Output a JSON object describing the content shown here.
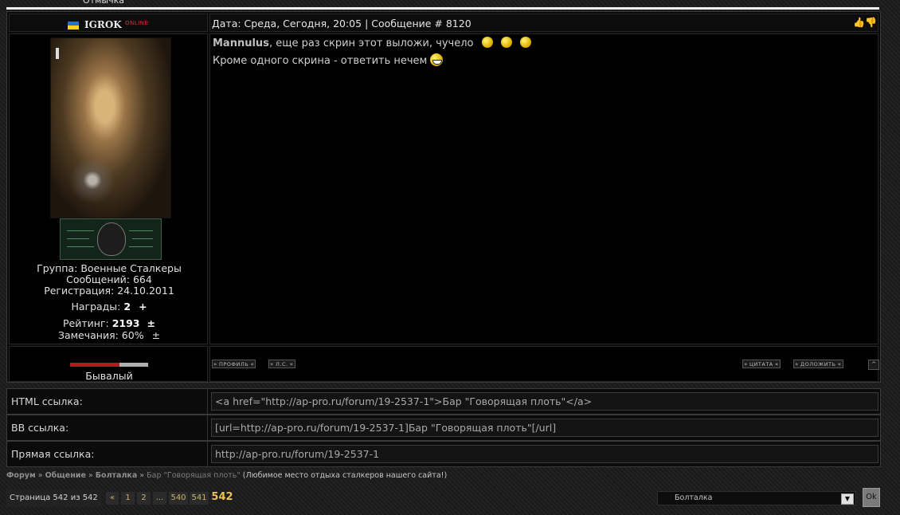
{
  "prev_post": {
    "label": "Отмычка"
  },
  "post": {
    "author": {
      "name": "IGROK",
      "status": "ONLINE"
    },
    "header": {
      "date_text": "Дата: Среда, Сегодня, 20:05 | Сообщение # 8120"
    },
    "info": {
      "group": "Группа: Военные Сталкеры",
      "messages": "Сообщений: 664",
      "registered": "Регистрация: 24.10.2011",
      "awards_label": "Награды:",
      "awards_value": "2",
      "awards_action": "+",
      "rating_label": "Рейтинг:",
      "rating_value": "2193",
      "rating_action": "±",
      "warnings": "Замечания: 60%",
      "warnings_action": "±"
    },
    "body": {
      "quote_name": "Mannulus",
      "line1": ", еще раз скрин этот выложи, чучело",
      "line2": "Кроме одного скрина - ответить нечем"
    },
    "rank": {
      "title": "Бывалый",
      "level": 0.63
    },
    "buttons": {
      "profile": "ПРОФИЛЬ",
      "pm": "Л.С.",
      "quote": "ЦИТАТА",
      "report": "ДОЛОЖИТЬ",
      "up": "^"
    }
  },
  "links": [
    {
      "label": "HTML ссылка:",
      "value": "<a href=\"http://ap-pro.ru/forum/19-2537-1\">Бар \"Говорящая плоть\"</a>"
    },
    {
      "label": "BB ссылка:",
      "value": "[url=http://ap-pro.ru/forum/19-2537-1]Бар \"Говорящая плоть\"[/url]"
    },
    {
      "label": "Прямая ссылка:",
      "value": "http://ap-pro.ru/forum/19-2537-1"
    }
  ],
  "breadcrumb": {
    "items": [
      "Форум",
      "Общение",
      "Болталка"
    ],
    "sep": "»",
    "current": "Бар \"Говорящая плоть\"",
    "description": "(Любимое место отдыха сталкеров нашего сайта!)"
  },
  "pagination": {
    "info": "Страница 542 из 542",
    "prev": "«",
    "pages": [
      "1",
      "2",
      "...",
      "540",
      "541"
    ],
    "current": "542"
  },
  "jump": {
    "selected": "Болталка",
    "ok": "Ok"
  },
  "colors": {
    "accent_gold": "#e9c259",
    "online_red": "#dd3333",
    "rank_red": "#b41c1c",
    "flag_blue": "#2a6fd6",
    "flag_yellow": "#ffd21e"
  },
  "icons": {
    "thumb_up": "thumb-up-icon",
    "thumb_down": "thumb-down-icon"
  }
}
